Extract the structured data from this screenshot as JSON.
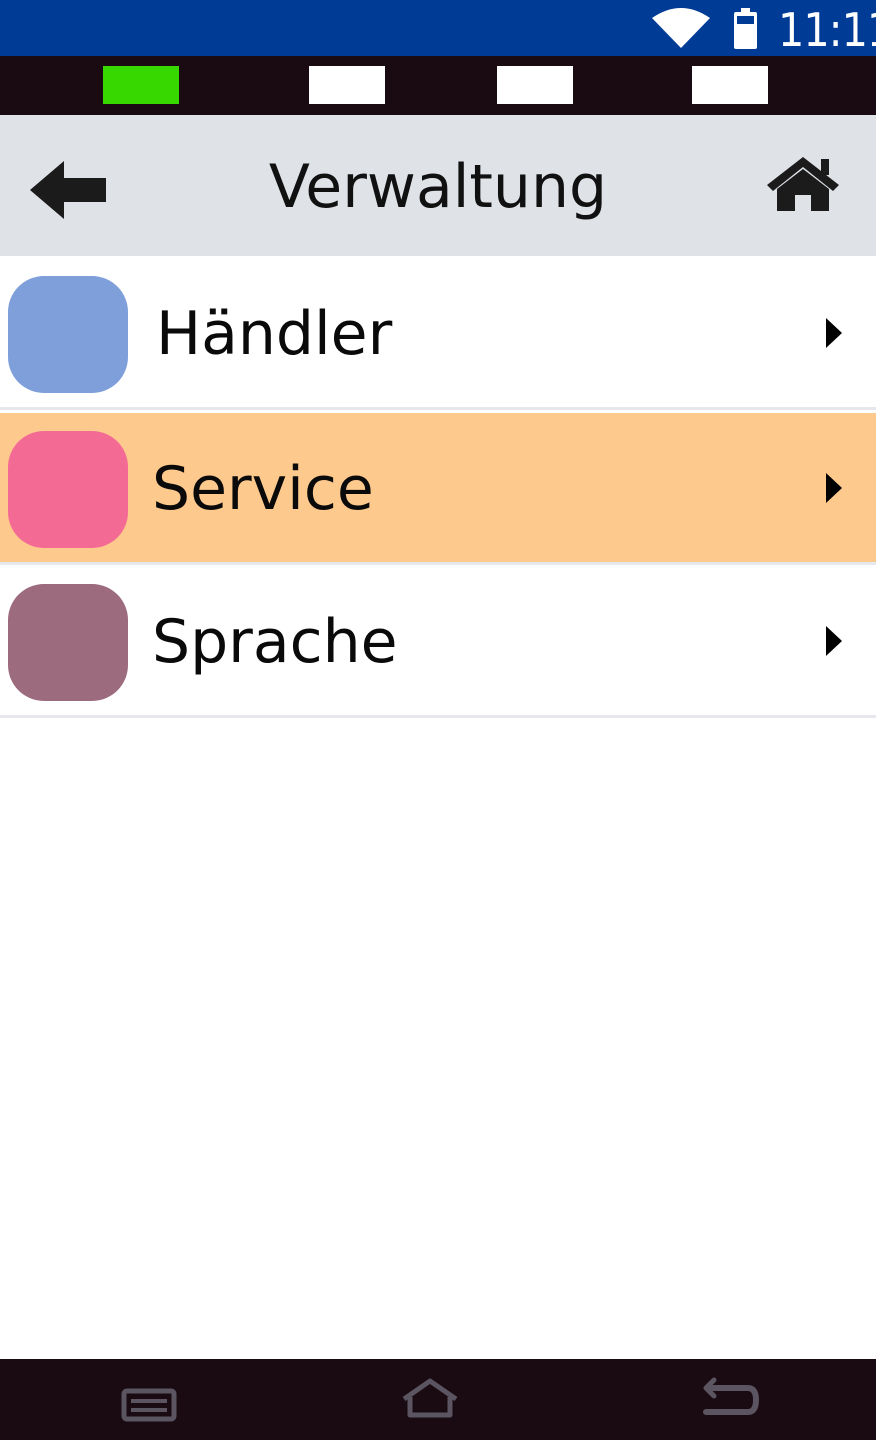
{
  "status_bar": {
    "time": "11:11",
    "wifi_icon": "wifi-icon",
    "battery_icon": "battery-icon",
    "background": "#003b95"
  },
  "page_indicators": {
    "count": 4,
    "active_index": 0,
    "active_color": "#37d800",
    "inactive_color": "#ffffff"
  },
  "header": {
    "title": "Verwaltung",
    "back_icon": "arrow-left-icon",
    "home_icon": "home-icon",
    "background": "#dfe2e7"
  },
  "menu": {
    "items": [
      {
        "label": "Händler",
        "color": "#7f9fda",
        "selected": false,
        "chevron_icon": "chevron-right-icon"
      },
      {
        "label": "Service",
        "color": "#f36b95",
        "selected": true,
        "chevron_icon": "chevron-right-icon"
      },
      {
        "label": "Sprache",
        "color": "#9c6b7e",
        "selected": false,
        "chevron_icon": "chevron-right-icon"
      }
    ],
    "selected_background": "#fec98c"
  },
  "nav_bar": {
    "buttons": [
      {
        "icon": "recent-apps-icon"
      },
      {
        "icon": "home-outline-icon"
      },
      {
        "icon": "back-return-icon"
      }
    ],
    "background": "#1a0b13"
  }
}
